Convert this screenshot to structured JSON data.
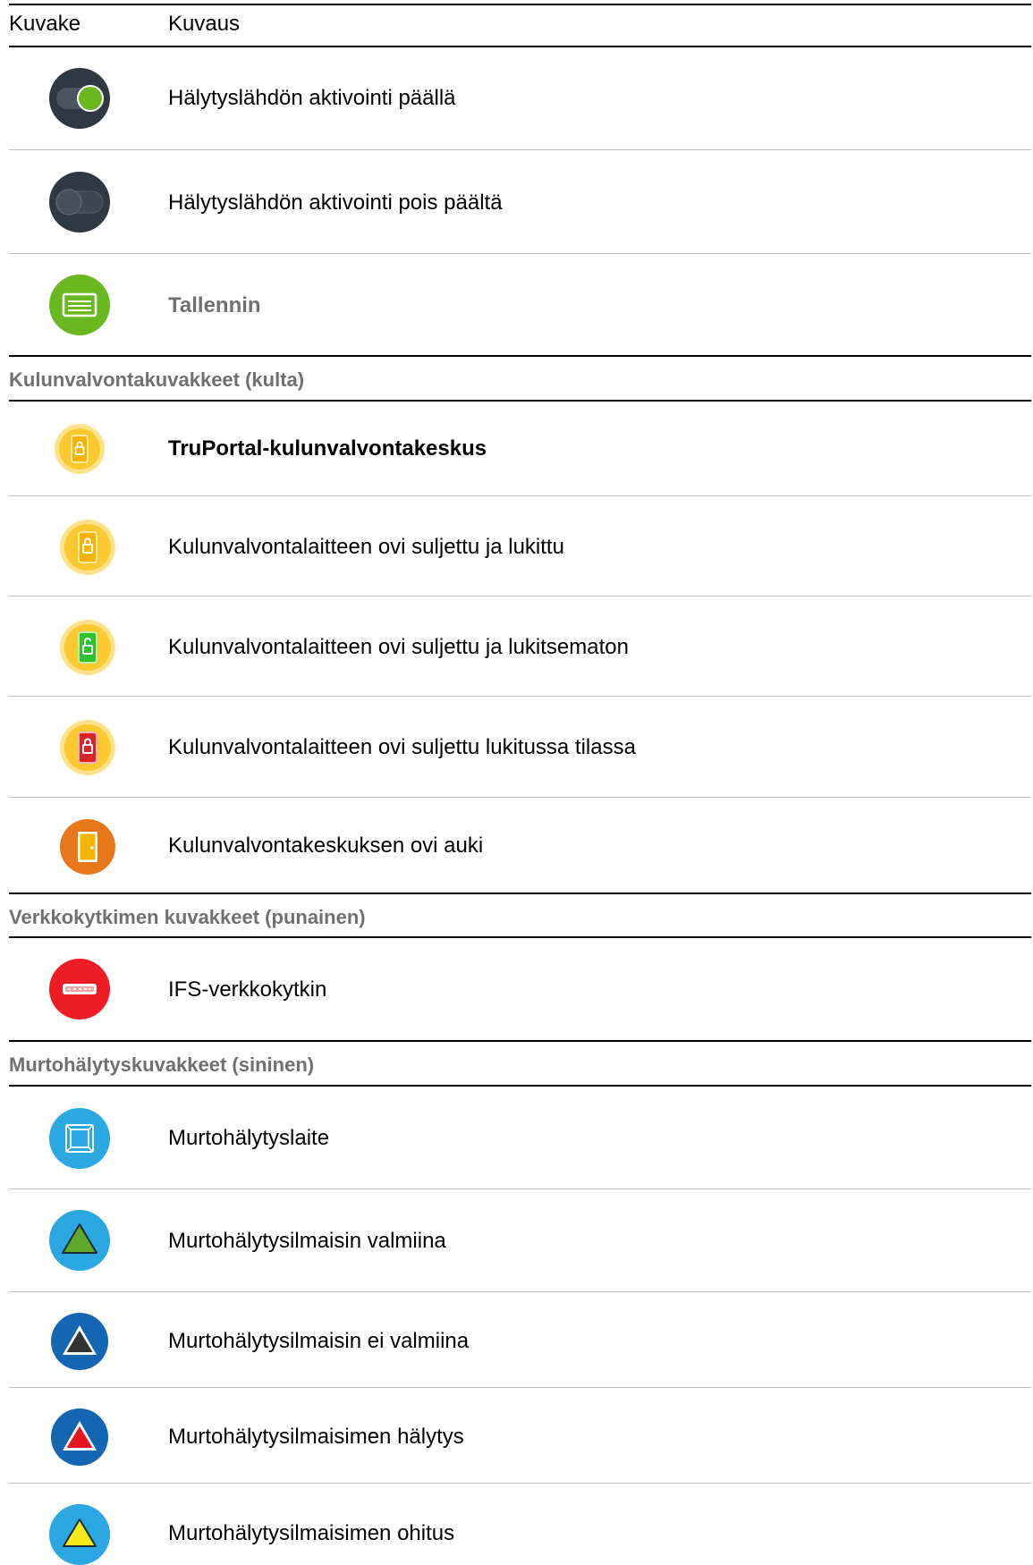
{
  "header": {
    "col_icon": "Kuvake",
    "col_desc": "Kuvaus"
  },
  "rows": {
    "alarm_output_on": {
      "icon": "toggle-on-icon",
      "text": "Hälytyslähdön aktivointi päällä"
    },
    "alarm_output_off": {
      "icon": "toggle-off-icon",
      "text": "Hälytyslähdön aktivointi pois päältä"
    },
    "recorder": {
      "icon": "recorder-icon",
      "text": "Tallennin"
    }
  },
  "sections": {
    "access": {
      "title": "Kulunvalvontakuvakkeet (kulta)",
      "rows": {
        "panel": {
          "icon": "access-panel-icon",
          "text": "TruPortal-kulunvalvontakeskus"
        },
        "locked": {
          "icon": "door-locked-icon",
          "text": "Kulunvalvontalaitteen ovi suljettu ja lukittu"
        },
        "unlocked": {
          "icon": "door-unlocked-icon",
          "text": "Kulunvalvontalaitteen ovi suljettu ja lukitsematon"
        },
        "lockdown": {
          "icon": "door-lockdown-icon",
          "text": "Kulunvalvontalaitteen ovi suljettu lukitussa tilassa"
        },
        "open": {
          "icon": "door-open-icon",
          "text": "Kulunvalvontakeskuksen ovi auki"
        }
      }
    },
    "network": {
      "title": "Verkkokytkimen kuvakkeet (punainen)",
      "rows": {
        "switch": {
          "icon": "network-switch-icon",
          "text": "IFS-verkkokytkin"
        }
      }
    },
    "intrusion": {
      "title": "Murtohälytyskuvakkeet (sininen)",
      "rows": {
        "device": {
          "icon": "intrusion-device-icon",
          "text": "Murtohälytyslaite"
        },
        "ready": {
          "icon": "sensor-ready-icon",
          "text": "Murtohälytysilmaisin valmiina"
        },
        "not_ready": {
          "icon": "sensor-not-ready-icon",
          "text": "Murtohälytysilmaisin ei valmiina"
        },
        "alarm": {
          "icon": "sensor-alarm-icon",
          "text": "Murtohälytysilmaisimen hälytys"
        },
        "bypass": {
          "icon": "sensor-bypass-icon",
          "text": "Murtohälytysilmaisimen ohitus"
        }
      }
    }
  },
  "colors": {
    "toggle_dark": "#2f3943",
    "toggle_green": "#6ab81f",
    "recorder_green": "#6ab81f",
    "gold": "#fbc830",
    "gold_inner": "#f6b300",
    "lock_green": "#2ec32e",
    "lock_red": "#d9242a",
    "door_orange": "#e8771a",
    "network_red": "#ee1c25",
    "intrusion_blue": "#2ba7e2",
    "intrusion_dark_blue": "#1466b3",
    "section_grey": "#707070"
  }
}
